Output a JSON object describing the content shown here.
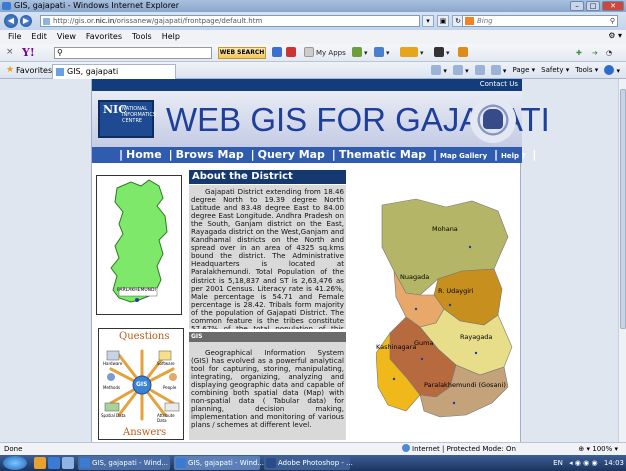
{
  "window": {
    "title": "GIS, gajapati - Windows Internet Explorer",
    "url_prefix": "http://gis.or.",
    "url_domain": "nic.in",
    "url_suffix": "/orissanew/gajapati/frontpage/default.htm",
    "search_placeholder": "Bing"
  },
  "menu": [
    "File",
    "Edit",
    "View",
    "Favorites",
    "Tools",
    "Help"
  ],
  "yahoo_toolbar": {
    "logo": "Y!",
    "search_button": "WEB SEARCH",
    "my_apps": "My Apps"
  },
  "favorites_bar": {
    "favorites_label": "Favorites",
    "tab_title": "GIS, gajapati",
    "commands": [
      "Page ▾",
      "Safety ▾",
      "Tools ▾"
    ]
  },
  "site": {
    "contact": "Contact Us",
    "nic_logo_text": "NATIONAL INFORMATICS CENTRE",
    "title": "WEB GIS FOR GAJAPATI",
    "nav": [
      "Home",
      "Brows Map",
      "Query Map",
      "Thematic Map"
    ],
    "nav_small": [
      "Map Gallery",
      "Help ?"
    ],
    "mini_map_caption": "PARLAKHEMUNDI",
    "qa": {
      "top": "Questions",
      "bottom": "Answers",
      "center": "GIS",
      "spokes": [
        "Hardware",
        "Software",
        "Methods",
        "People",
        "Spatial Data",
        "Attribute Data"
      ]
    },
    "about_title": "About the District",
    "about_text": "Gajapati District extending from 18.46 degree North to 19.39 degree North Latitude and 83.48 degree East to 84.00 degree East Longitude. Andhra Pradesh on the South, Ganjam district on the East, Rayagada district on the West,Ganjam and Kandhamal districts on the North and spread over in an area of 4325 sq.kms bound the district. The Administrative Headquarters is located at Paralakhemundi. Total Population of the district is 5,18,837 and ST is 2,63,476 as per 2001 Census. Literacy rate is 41.26%, Male percentage is 54.71 and Female percentage is 28.42. Tribals form majority of the population of Gajapati District. The common feature is the tribes constitute 57.67% of the total population of this district. The District Hq. is at Parlakhemundi.",
    "gis_title": "GIS",
    "gis_text": "Geographical Information System (GIS) has evolved as a powerful analytical tool for capturing, storing, manipulating, integrating, organizing, analyzing and displaying geographic data and capable of combining both spatial data (Map) with non-spatial data ( Tabular data) for planning, decision making, implementation and monitoring of various plans / schemes at different level.",
    "map_labels": {
      "mohana": "Mohana",
      "nuagada": "Nuagada",
      "rudayagiri": "R. Udaygiri",
      "rayagada": "Rayagada",
      "guma": "Guma",
      "kashinagara": "Kashinagara",
      "paralakhemundi": "Paralakhemundi (Gosani)"
    }
  },
  "status": {
    "left": "Done",
    "zone": "Internet | Protected Mode: On",
    "zoom": "100%"
  },
  "taskbar": {
    "tasks": [
      "GIS, gajapati - Wind...",
      "GIS, gajapati - Wind...",
      "Adobe Photoshop - ..."
    ],
    "lang": "EN",
    "clock": "14:03"
  },
  "colors": {
    "nav_blue": "#2f5cae",
    "header_dark": "#123c7a",
    "title_blue": "#1e3f9a",
    "about_bar": "#14386f",
    "map_mohana": "#b5b568",
    "map_udaygiri": "#c78f1d",
    "map_nuagada": "#e8a86a",
    "map_rayagada": "#e8de8a",
    "map_guma": "#b86a3f",
    "map_kashinagara": "#f0b81a",
    "map_gosani": "#c4a27a"
  }
}
